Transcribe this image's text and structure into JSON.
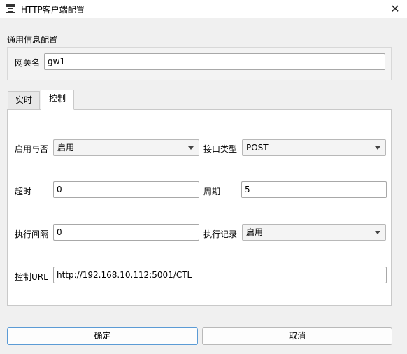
{
  "window": {
    "title": "HTTP客户端配置",
    "close_glyph": "✕",
    "icon": "app-window-icon"
  },
  "general": {
    "section_label": "通用信息配置",
    "gateway_label": "网关名",
    "gateway_value": "gw1"
  },
  "tabs": [
    {
      "label": "实时",
      "active": false
    },
    {
      "label": "控制",
      "active": true
    }
  ],
  "control": {
    "enable_label": "启用与否",
    "enable_value": "启用",
    "interface_type_label": "接口类型",
    "interface_type_value": "POST",
    "timeout_label": "超时",
    "timeout_value": "0",
    "period_label": "周期",
    "period_value": "5",
    "exec_interval_label": "执行间隔",
    "exec_interval_value": "0",
    "exec_log_label": "执行记录",
    "exec_log_value": "启用",
    "url_label": "控制URL",
    "url_value": "http://192.168.10.112:5001/CTL"
  },
  "buttons": {
    "ok": "确定",
    "cancel": "取消"
  }
}
